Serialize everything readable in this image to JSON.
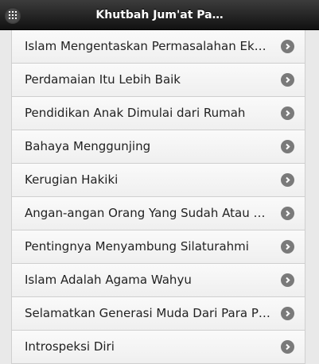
{
  "header": {
    "title": "Khutbah Jum'at Pa…"
  },
  "list": {
    "items": [
      {
        "label": "Islam Mengentaskan Permasalahan Ek…"
      },
      {
        "label": "Perdamaian Itu Lebih Baik"
      },
      {
        "label": "Pendidikan Anak Dimulai dari Rumah"
      },
      {
        "label": "Bahaya Menggunjing"
      },
      {
        "label": "Kerugian Hakiki"
      },
      {
        "label": "Angan-angan Orang Yang Sudah Atau …"
      },
      {
        "label": "Pentingnya Menyambung Silaturahmi"
      },
      {
        "label": "Islam Adalah Agama Wahyu"
      },
      {
        "label": "Selamatkan Generasi Muda Dari Para P…"
      },
      {
        "label": "Introspeksi Diri"
      }
    ]
  },
  "colors": {
    "header_bg": "#1a1a1a",
    "item_bg": "#f6f6f6",
    "chevron": "#7a7a7a"
  }
}
